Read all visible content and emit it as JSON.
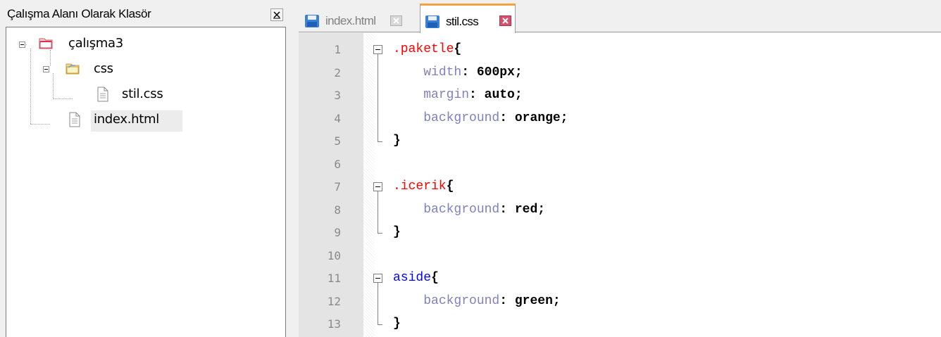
{
  "left_panel": {
    "title": "Çalışma Alanı Olarak Klasör",
    "tree": {
      "root": "çalışma3",
      "folder": "css",
      "file_css": "stil.css",
      "file_html": "index.html"
    }
  },
  "editor": {
    "tabs": [
      {
        "label": "index.html",
        "active": false
      },
      {
        "label": "stil.css",
        "active": true
      }
    ],
    "lines": [
      {
        "n": "1",
        "parts": [
          {
            "t": ".paketle",
            "c": "sel"
          },
          {
            "t": "{",
            "c": "punc"
          }
        ]
      },
      {
        "n": "2",
        "parts": [
          {
            "t": "    ",
            "c": ""
          },
          {
            "t": "width",
            "c": "prop"
          },
          {
            "t": ": ",
            "c": "punc"
          },
          {
            "t": "600px",
            "c": "val"
          },
          {
            "t": ";",
            "c": "punc"
          }
        ]
      },
      {
        "n": "3",
        "parts": [
          {
            "t": "    ",
            "c": ""
          },
          {
            "t": "margin",
            "c": "prop"
          },
          {
            "t": ": ",
            "c": "punc"
          },
          {
            "t": "auto",
            "c": "val"
          },
          {
            "t": ";",
            "c": "punc"
          }
        ]
      },
      {
        "n": "4",
        "parts": [
          {
            "t": "    ",
            "c": ""
          },
          {
            "t": "background",
            "c": "prop"
          },
          {
            "t": ": ",
            "c": "punc"
          },
          {
            "t": "orange",
            "c": "val"
          },
          {
            "t": ";",
            "c": "punc"
          }
        ]
      },
      {
        "n": "5",
        "parts": [
          {
            "t": "}",
            "c": "punc"
          }
        ]
      },
      {
        "n": "6",
        "parts": []
      },
      {
        "n": "7",
        "parts": [
          {
            "t": ".icerik",
            "c": "sel"
          },
          {
            "t": "{",
            "c": "punc"
          }
        ]
      },
      {
        "n": "8",
        "parts": [
          {
            "t": "    ",
            "c": ""
          },
          {
            "t": "background",
            "c": "prop"
          },
          {
            "t": ": ",
            "c": "punc"
          },
          {
            "t": "red",
            "c": "val"
          },
          {
            "t": ";",
            "c": "punc"
          }
        ]
      },
      {
        "n": "9",
        "parts": [
          {
            "t": "}",
            "c": "punc"
          }
        ]
      },
      {
        "n": "10",
        "parts": []
      },
      {
        "n": "11",
        "parts": [
          {
            "t": "aside",
            "c": "tag"
          },
          {
            "t": "{",
            "c": "punc"
          }
        ]
      },
      {
        "n": "12",
        "parts": [
          {
            "t": "    ",
            "c": ""
          },
          {
            "t": "background",
            "c": "prop"
          },
          {
            "t": ": ",
            "c": "punc"
          },
          {
            "t": "green",
            "c": "val"
          },
          {
            "t": ";",
            "c": "punc"
          }
        ]
      },
      {
        "n": "13",
        "parts": [
          {
            "t": "}",
            "c": "punc"
          }
        ]
      }
    ]
  },
  "colors": {
    "selector": "#ff0000",
    "tag": "#0000ff",
    "property": "#8080c0",
    "active_tab_accent": "#f4a23c"
  },
  "icons": [
    "close-panel-icon",
    "project-folder-icon",
    "folder-icon",
    "file-icon",
    "save-disk-icon",
    "tab-close-icon",
    "fold-minus-icon"
  ]
}
